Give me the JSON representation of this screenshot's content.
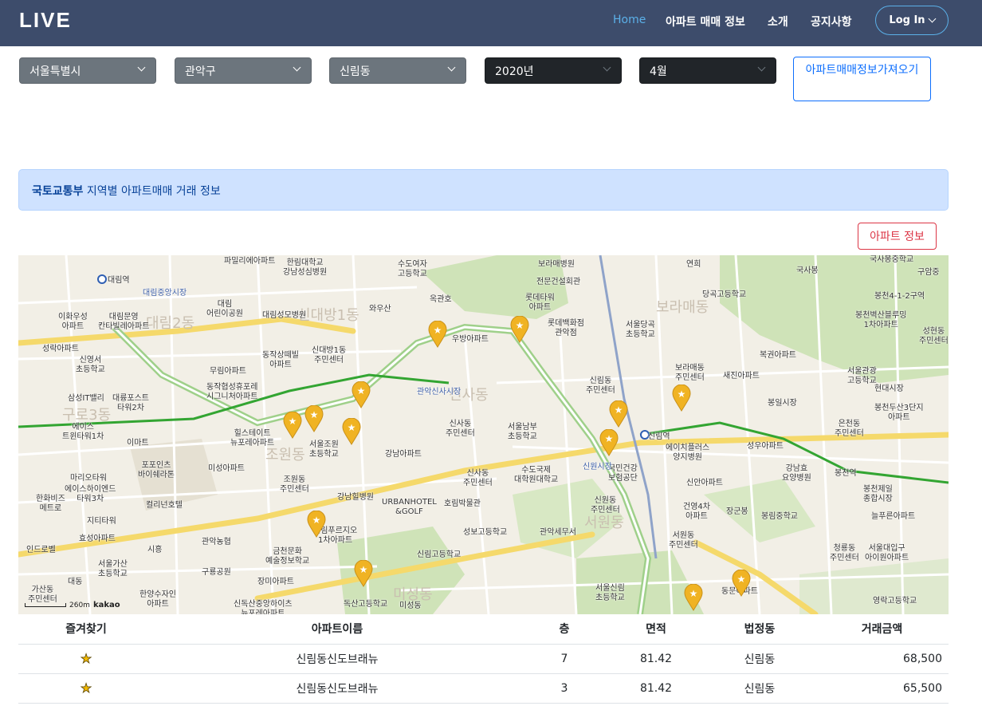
{
  "navbar": {
    "brand": "LIVE",
    "links": [
      "Home",
      "아파트 매매 정보",
      "소개",
      "공지사항"
    ],
    "login": "Log In"
  },
  "filters": {
    "city": "서울특별시",
    "district": "관악구",
    "dong": "신림동",
    "year": "2020년",
    "month": "4월",
    "fetch_button": "아파트매매정보가져오기"
  },
  "alert": {
    "bold": "국토교통부",
    "text": " 지역별 아파트매매 거래 정보"
  },
  "apt_info_button": "아파트 정보",
  "map": {
    "scale_text": "260m",
    "provider": "kakao",
    "area_names": [
      "대림2동",
      "신대방1동",
      "보라매동",
      "신사동",
      "조원동",
      "구로3동",
      "서원동",
      "미성동"
    ],
    "place_labels": [
      "대림역",
      "대림중앙시장",
      "이화우성\n아파트",
      "대림문영\n칸타빌레아파트",
      "성락아파트",
      "신영서\n초등학교",
      "삼성IT밸리",
      "대륭포스트\n타워2차",
      "에이스\n트윈타워1차",
      "이마트",
      "포포인츠\n바이쉐라톤",
      "마리오타워",
      "에이스하이엔드\n타워3차",
      "한화비즈\n메트로",
      "컬리넌호텔",
      "지티타워",
      "효성아파트",
      "시흥",
      "인드로벨",
      "서울가산\n초등학교",
      "가산동\n주민센터",
      "대동",
      "한양수자인\n아파트",
      "파밀리에아파트",
      "한림대학교\n강남성심병원",
      "대림\n어린이공원",
      "대림성모병원",
      "신대방1동\n주민센터",
      "동작상떼빌\n아파트",
      "무림아파트",
      "동작협성휴포레\n시그니처아파트",
      "힐스테이트\n뉴포레아파트",
      "서울조원\n초등학교",
      "조원동\n주민센터",
      "미성아파트",
      "강남힐병원",
      "신림푸르지오\n1차아파트",
      "금천문화\n예술정보학교",
      "관악농협",
      "구룡공원",
      "장미아파트",
      "신독산중앙하이츠\n뉴포레아파트",
      "독산고등학교",
      "미성동",
      "수도여자\n고등학교",
      "와우산",
      "옥관호",
      "보라매병원",
      "전문건설회관",
      "롯데타워\n아파트",
      "롯데백화점\n관악점",
      "우방아파트",
      "관악신사시장",
      "신사동\n주민센터",
      "서울남부\n초등학교",
      "강남아파트",
      "신사동\n주민센터",
      "수도국제\n대학원대학교",
      "호림박물관",
      "URBANHOTEL\n&GOLF",
      "성보고등학교",
      "신림고등학교",
      "관악세무서",
      "서울당곡\n초등학교",
      "신림동\n주민센터",
      "보라매동\n주민센터",
      "새진아파트",
      "신림역",
      "에이치플러스\n양지병원",
      "국민건강\n보험공단",
      "신원동\n주민센터",
      "서원동\n주민센터",
      "신안아파트",
      "건영4차\n아파트",
      "장군봉",
      "서울신림\n초등학교",
      "동문아파트",
      "연희",
      "국사봉",
      "당곡고등학교",
      "복권아파트",
      "봉일시장",
      "성우아파트",
      "강남효\n요양병원",
      "봉천제일\n종합시장",
      "봉림중학교",
      "청룡동\n주민센터",
      "서울대입구\n아이원아파트",
      "영락고등학교",
      "국사봉중학교",
      "구암중",
      "봉천4-1-2구역",
      "봉천벽산블루밍\n1차아파트",
      "성현동\n주민센터",
      "서울관광\n고등학교",
      "현대시장",
      "봉천두산3단지\n아파트",
      "은천동\n주민센터",
      "봉천역",
      "늘푸른아파트",
      "신원시장"
    ]
  },
  "table": {
    "headers": [
      "즐겨찾기",
      "아파트이름",
      "층",
      "면적",
      "법정동",
      "거래금액"
    ],
    "rows": [
      {
        "favorite": "★",
        "name": "신림동신도브래뉴",
        "floor": "7",
        "area": "81.42",
        "dong": "신림동",
        "price": "68,500"
      },
      {
        "favorite": "★",
        "name": "신림동신도브래뉴",
        "floor": "3",
        "area": "81.42",
        "dong": "신림동",
        "price": "65,500"
      }
    ]
  }
}
